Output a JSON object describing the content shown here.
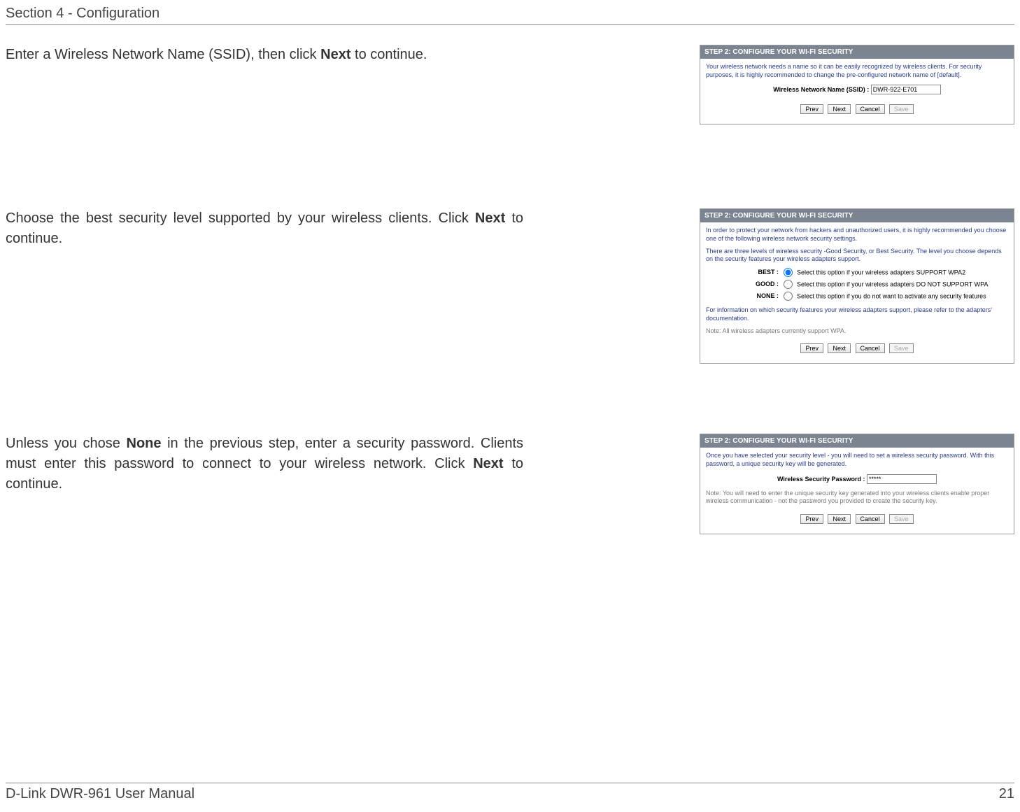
{
  "header": {
    "section": "Section 4 - Configuration"
  },
  "footer": {
    "left": "D-Link DWR-961 User Manual",
    "right": "21"
  },
  "instr1": {
    "pre": "Enter a Wireless Network Name (SSID), then click ",
    "bold": "Next",
    "post": " to continue."
  },
  "instr2": {
    "pre": "Choose the best security level supported by your wireless clients. Click ",
    "bold": "Next",
    "post": " to continue."
  },
  "instr3": {
    "pre": "Unless you chose ",
    "bold1": "None",
    "mid": " in the previous step, enter a security password. Clients must enter this password to connect to your wireless network. Click ",
    "bold2": "Next",
    "post": " to continue."
  },
  "panel_title": "STEP 2: CONFIGURE YOUR WI-FI SECURITY",
  "panel1": {
    "desc": "Your wireless network needs a name so it can be easily recognized by wireless clients. For security purposes, it is highly recommended to change the pre-configured network name of [default].",
    "field_label": "Wireless Network Name (SSID) :",
    "field_value": "DWR-922-E701"
  },
  "panel2": {
    "desc1": "In order to protect your network from hackers and unauthorized users, it is highly recommended you choose one of the following wireless network security settings.",
    "desc2": "There are three levels of wireless security -Good Security, or Best Security. The level you choose depends on the security features your wireless adapters support.",
    "opt_best": {
      "label": "BEST :",
      "text": "Select this option if your wireless adapters SUPPORT WPA2"
    },
    "opt_good": {
      "label": "GOOD :",
      "text": "Select this option if your wireless adapters DO NOT SUPPORT WPA"
    },
    "opt_none": {
      "label": "NONE :",
      "text": "Select this option if you do not want to activate any security features"
    },
    "footnote": "For information on which security features your wireless adapters support, please refer to the adapters' documentation.",
    "note": "Note: All wireless adapters currently support WPA."
  },
  "panel3": {
    "desc": "Once you have selected your security level - you will need to set a wireless security password. With this password, a unique security key will be generated.",
    "field_label": "Wireless Security Password :",
    "field_value": "*****",
    "note": "Note: You will need to enter the unique security key generated into your wireless clients enable proper wireless communication - not the password you provided to create the security key."
  },
  "buttons": {
    "prev": "Prev",
    "next": "Next",
    "cancel": "Cancel",
    "save": "Save"
  }
}
